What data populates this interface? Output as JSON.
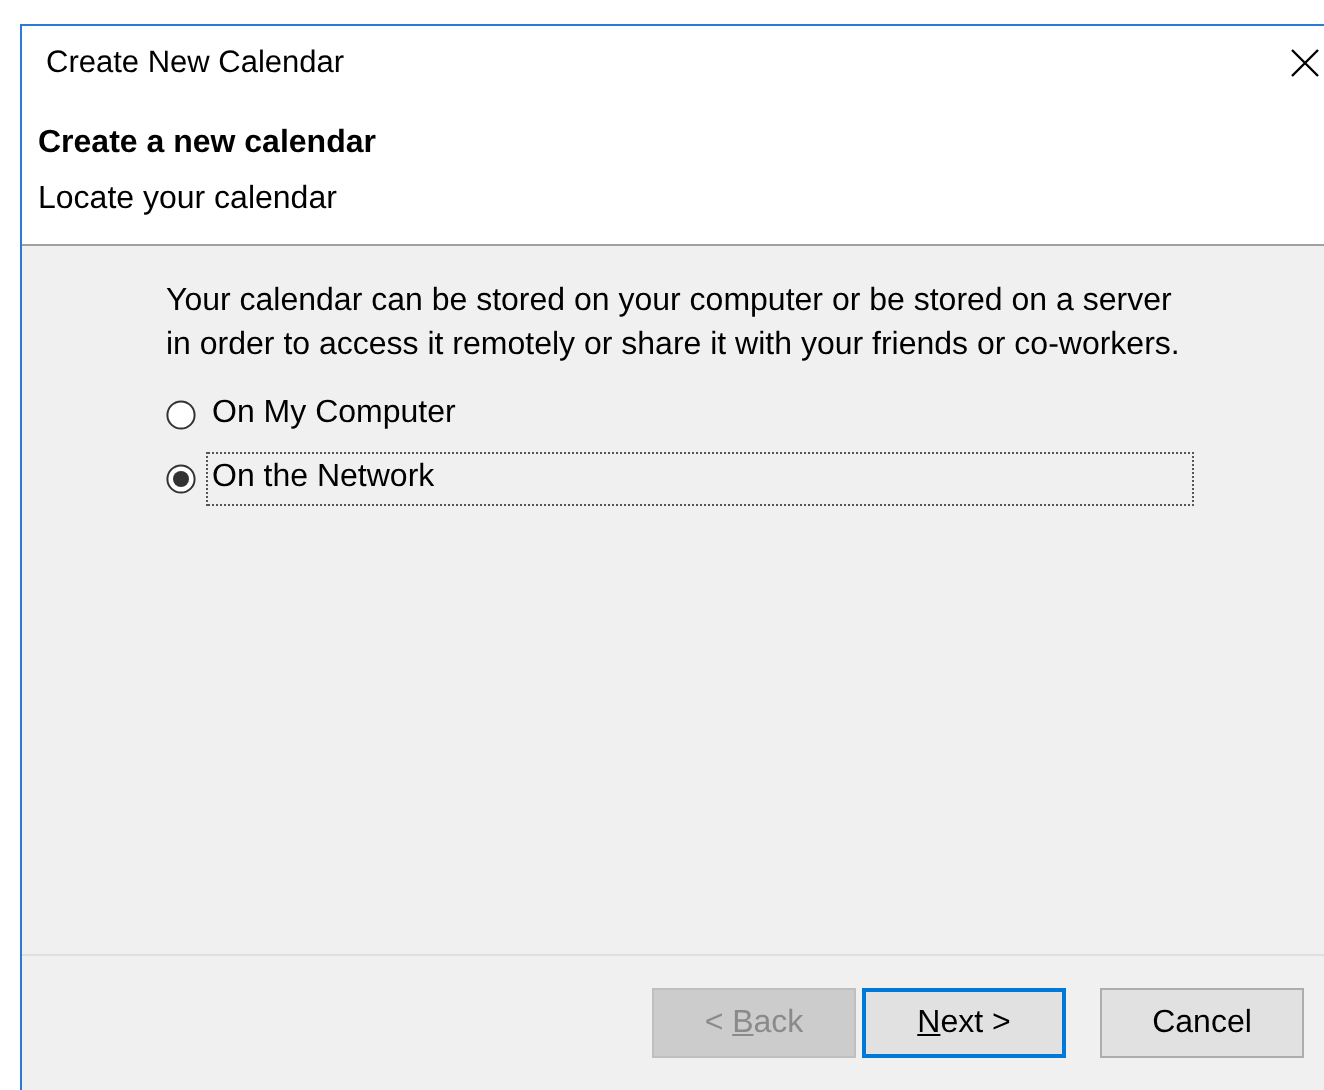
{
  "window": {
    "title": "Create New Calendar"
  },
  "header": {
    "title": "Create a new calendar",
    "subtitle": "Locate your calendar"
  },
  "description": "Your calendar can be stored on your computer or be stored on a server in order to access it remotely or share it with your friends or co-workers.",
  "options": [
    {
      "label": "On My Computer",
      "selected": false,
      "focused": false
    },
    {
      "label": "On the Network",
      "selected": true,
      "focused": true
    }
  ],
  "buttons": [
    {
      "label": {
        "before": "< ",
        "access_key": "B",
        "after": "ack"
      },
      "disabled": true,
      "default": false
    },
    {
      "label": {
        "access_key": "N",
        "after": "ext >"
      },
      "disabled": false,
      "default": true
    },
    {
      "label": {
        "before": "Cancel"
      },
      "disabled": false,
      "default": false
    }
  ]
}
